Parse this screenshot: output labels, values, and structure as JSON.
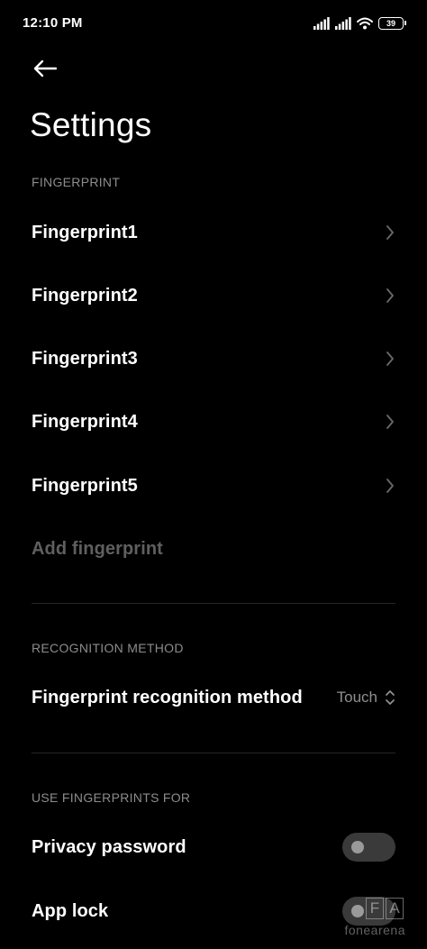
{
  "status_bar": {
    "time": "12:10 PM",
    "battery_level": "39",
    "icons": [
      "signal-icon",
      "signal-icon",
      "wifi-icon",
      "battery-icon"
    ]
  },
  "header": {
    "back_icon": "back-arrow-icon",
    "title": "Settings"
  },
  "fingerprint_section": {
    "header": "FINGERPRINT",
    "items": [
      {
        "label": "Fingerprint1"
      },
      {
        "label": "Fingerprint2"
      },
      {
        "label": "Fingerprint3"
      },
      {
        "label": "Fingerprint4"
      },
      {
        "label": "Fingerprint5"
      }
    ],
    "add_label": "Add fingerprint"
  },
  "recognition_section": {
    "header": "RECOGNITION METHOD",
    "method_label": "Fingerprint recognition method",
    "method_value": "Touch"
  },
  "use_section": {
    "header": "USE FINGERPRINTS FOR",
    "items": [
      {
        "label": "Privacy password",
        "enabled": false
      },
      {
        "label": "App lock",
        "enabled": false
      }
    ]
  },
  "watermark": {
    "letters": [
      "F",
      "A"
    ],
    "text": "fonearena"
  },
  "colors": {
    "background": "#000000",
    "primary_text": "#ffffff",
    "secondary_text": "#8c8c8c",
    "disabled_text": "#5f5f5f",
    "toggle_off": "#3a3a3a"
  }
}
